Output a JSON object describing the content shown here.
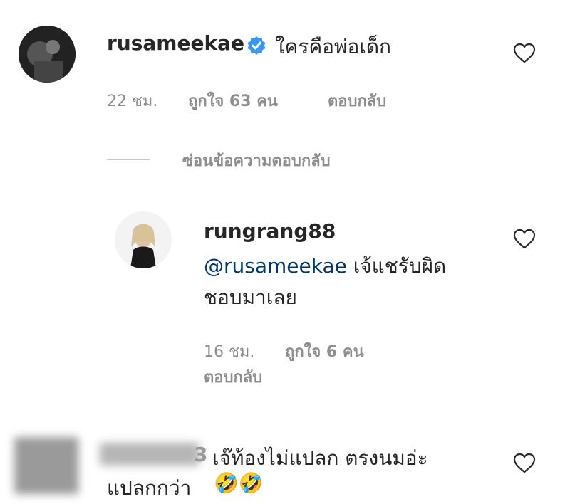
{
  "comments": [
    {
      "username": "rusameekae",
      "verified": true,
      "text": "ใครคือพ่อเด็ก",
      "time": "22 ชม.",
      "likes": "ถูกใจ 63 คน",
      "reply_label": "ตอบกลับ",
      "hide_replies_label": "ซ่อนข้อความตอบกลับ"
    }
  ],
  "reply": {
    "username": "rungrang88",
    "mention": "@rusameekae",
    "text_line1": "เจ้แชรับผิด",
    "text_line2": "ชอบมาเลย",
    "time": "16 ชม.",
    "likes": "ถูกใจ 6 คน",
    "reply_label": "ตอบกลับ"
  },
  "third_comment": {
    "username_partial": "3",
    "text_line1": "เจ๊ท้องไม่แปลก ตรงนมอ่ะ",
    "text_line2": "แปลกกว่า",
    "emoji": "🤣🤣"
  },
  "colors": {
    "verified": "#3897f0",
    "text": "#262626",
    "meta": "#8e8e8e",
    "mention": "#00376b"
  },
  "icons": [
    "heart-icon",
    "verified-badge-icon"
  ]
}
